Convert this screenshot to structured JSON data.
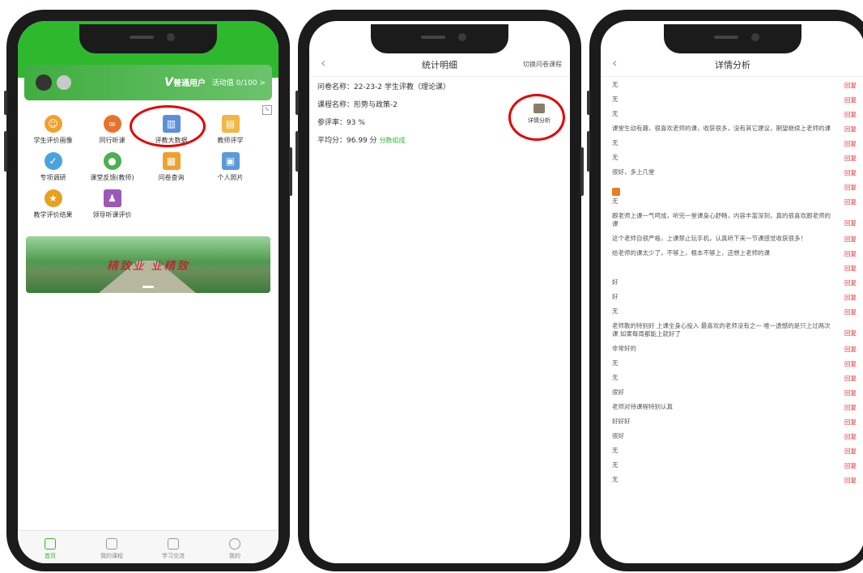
{
  "top_caption": "、……，…………………",
  "phone1": {
    "card": {
      "user_type": "普通用户",
      "count_label": "活动值 0/100 >"
    },
    "menu": [
      {
        "label": "学生评价画像",
        "color": "#f0a030"
      },
      {
        "label": "同行听课",
        "color": "#e8722c"
      },
      {
        "label": "评教大数据",
        "color": "#5b8fd8"
      },
      {
        "label": "教师评学",
        "color": "#f2b742"
      },
      {
        "label": "专项调研",
        "color": "#4aa3df"
      },
      {
        "label": "课堂反馈(教师)",
        "color": "#4caf50"
      },
      {
        "label": "问卷查询",
        "color": "#f0a030"
      },
      {
        "label": "个人照片",
        "color": "#5b9bd5"
      },
      {
        "label": "教学评价结果",
        "color": "#e8a020"
      },
      {
        "label": "领导听课评价",
        "color": "#9b59b6"
      }
    ],
    "banner_text": "精致业 业精致",
    "tabs": [
      {
        "label": "首页"
      },
      {
        "label": "我的课程"
      },
      {
        "label": "学习交流"
      },
      {
        "label": "我的"
      }
    ]
  },
  "phone2": {
    "title": "统计明细",
    "right_link": "切换问卷课程",
    "survey_name": "问卷名称：22-23-2 学生评教（理论课）",
    "course_name": "课程名称：形势与政策-2",
    "participation": "参评率：93 %",
    "average_score": "平均分：96.99 分",
    "score_detail": "分数组成",
    "detail_button": "详情分析"
  },
  "phone3": {
    "title": "详情分析",
    "reply_label": "回复",
    "rows": [
      "无",
      "无",
      "无",
      "课堂生动有趣，很喜欢老师的课，收获很多，没有其它建议，期望继续上老师的课",
      "无",
      "无",
      "很好，多上几堂",
      "",
      "无",
      "跟老师上课一气呵成，听完一堂课身心舒畅，内容丰富深刻，真的很喜欢跟老师的课",
      "这个老师自很严格，上课禁止玩手机，认真听下来一节课感觉收获很多！",
      "给老师的课太少了，不够上，根本不够上，还想上老师的课",
      "",
      "好",
      "好",
      "无",
      "老师教的特别好 上课全身心投入 最喜欢的老师没有之一 唯一遗憾的是只上过两次课 如果每周都能上就好了",
      "非常好的",
      "无",
      "无",
      "很好",
      "老师对待课程特别认真",
      "好好好",
      "很好",
      "无",
      "无",
      "无"
    ]
  }
}
